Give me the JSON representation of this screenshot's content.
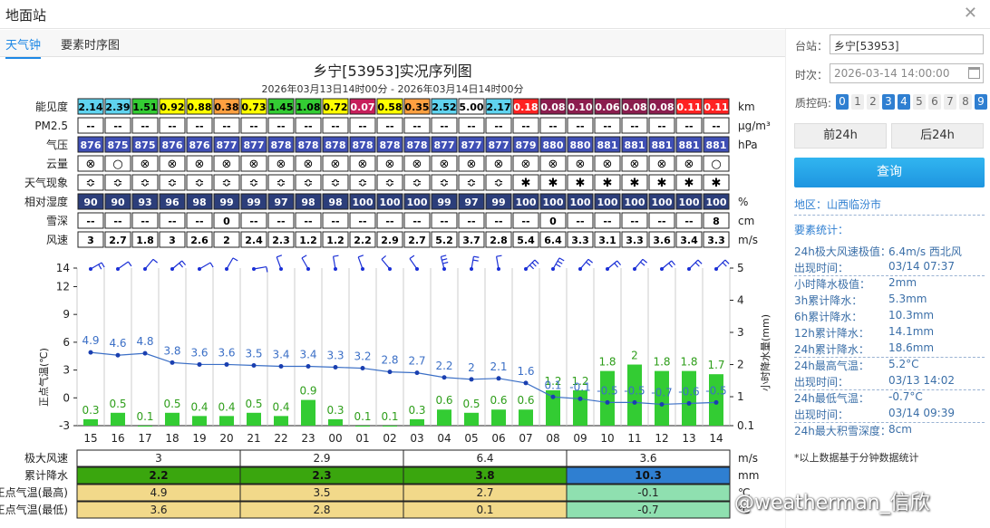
{
  "window": {
    "title": "地面站"
  },
  "tabs": [
    "天气钟",
    "要素时序图"
  ],
  "chart": {
    "title": "乡宁[53953]实况序列图",
    "subtitle": "2026年03月13日14时00分 - 2026年03月14日14时00分"
  },
  "hours": [
    "15",
    "16",
    "17",
    "18",
    "19",
    "20",
    "21",
    "22",
    "23",
    "00",
    "01",
    "02",
    "03",
    "04",
    "05",
    "06",
    "07",
    "08",
    "09",
    "10",
    "11",
    "12",
    "13",
    "14"
  ],
  "table": {
    "rows": [
      {
        "label": "能见度",
        "unit": "km",
        "values": [
          "2.14",
          "2.39",
          "1.51",
          "0.92",
          "0.88",
          "0.38",
          "0.73",
          "1.45",
          "1.08",
          "0.72",
          "0.07",
          "0.58",
          "0.35",
          "2.52",
          "5.00",
          "2.17",
          "0.18",
          "0.08",
          "0.10",
          "0.06",
          "0.08",
          "0.08",
          "0.11",
          "0.11"
        ],
        "colors": [
          "#5fd3ef",
          "#5fd3ef",
          "#33cc33",
          "#ffff00",
          "#ffff00",
          "#ffa040",
          "#ffff00",
          "#33cc33",
          "#33cc33",
          "#ffff00",
          "#c71f5b",
          "#ffff00",
          "#ffa040",
          "#5fd3ef",
          "#ffffff",
          "#5fd3ef",
          "#ff2222",
          "#8b1d4e",
          "#8b1d4e",
          "#8b1d4e",
          "#8b1d4e",
          "#8b1d4e",
          "#ff2222",
          "#ff2222"
        ]
      },
      {
        "label": "PM2.5",
        "unit": "μg/m³",
        "values": [
          "--",
          "--",
          "--",
          "--",
          "--",
          "--",
          "--",
          "--",
          "--",
          "--",
          "--",
          "--",
          "--",
          "--",
          "--",
          "--",
          "--",
          "--",
          "--",
          "--",
          "--",
          "--",
          "--",
          "--"
        ]
      },
      {
        "label": "气压",
        "unit": "hPa",
        "values": [
          "876",
          "875",
          "875",
          "876",
          "876",
          "877",
          "877",
          "878",
          "878",
          "878",
          "878",
          "878",
          "878",
          "877",
          "877",
          "877",
          "879",
          "880",
          "880",
          "881",
          "881",
          "881",
          "881",
          "881"
        ],
        "bg": "#3f4fb5"
      },
      {
        "label": "云量",
        "unit": "",
        "values": [
          "⊗",
          "○",
          "⊗",
          "⊗",
          "⊗",
          "⊗",
          "⊗",
          "⊗",
          "⊗",
          "⊗",
          "⊗",
          "⊗",
          "⊗",
          "⊗",
          "⊗",
          "⊗",
          "⊗",
          "⊗",
          "⊗",
          "⊗",
          "⊗",
          "⊗",
          "⊗",
          "○"
        ]
      },
      {
        "label": "天气现象",
        "unit": "",
        "values": [
          "≎",
          "≎",
          "≎",
          "≎",
          "≎",
          "≎",
          "≎",
          "≎",
          "≎",
          "≎",
          "≎",
          "≎",
          "≎",
          "≎",
          "≎",
          "≎",
          "✱",
          "✱",
          "✱",
          "✱",
          "✱",
          "✱",
          "✱",
          "✱"
        ]
      },
      {
        "label": "相对湿度",
        "unit": "%",
        "values": [
          "90",
          "90",
          "93",
          "96",
          "98",
          "99",
          "99",
          "97",
          "98",
          "98",
          "100",
          "100",
          "100",
          "99",
          "97",
          "99",
          "100",
          "100",
          "100",
          "100",
          "100",
          "100",
          "100",
          "100"
        ],
        "bg": "#2c3e7a"
      },
      {
        "label": "雪深",
        "unit": "cm",
        "values": [
          "--",
          "--",
          "--",
          "--",
          "--",
          "0",
          "--",
          "--",
          "--",
          "--",
          "--",
          "--",
          "--",
          "--",
          "--",
          "--",
          "--",
          "0",
          "--",
          "--",
          "--",
          "--",
          "--",
          "8"
        ]
      },
      {
        "label": "风速",
        "unit": "m/s",
        "values": [
          "3",
          "2.7",
          "1.8",
          "3",
          "2.6",
          "2",
          "2.4",
          "2.3",
          "1.2",
          "1.2",
          "2.2",
          "2.9",
          "2.7",
          "5.2",
          "3.7",
          "2.8",
          "5.4",
          "6.4",
          "3.3",
          "3.1",
          "3.3",
          "3.6",
          "3.4",
          "3.3"
        ]
      }
    ]
  },
  "plot": {
    "left_axis_label": "正点气温(℃)",
    "right_axis_label": "小时降水量(mm)",
    "left_ticks": [
      "14",
      "12",
      "9",
      "6",
      "3",
      "0",
      "-3"
    ],
    "right_ticks": [
      "5",
      "4",
      "3",
      "2",
      "1",
      "0.1"
    ]
  },
  "chart_data": {
    "type": "bar",
    "categories": [
      "15",
      "16",
      "17",
      "18",
      "19",
      "20",
      "21",
      "22",
      "23",
      "00",
      "01",
      "02",
      "03",
      "04",
      "05",
      "06",
      "07",
      "08",
      "09",
      "10",
      "11",
      "12",
      "13",
      "14"
    ],
    "series": [
      {
        "type": "bar",
        "values": [
          0.3,
          0.5,
          0.1,
          0.5,
          0.4,
          0.4,
          0.5,
          0.4,
          0.9,
          0.3,
          0.1,
          0.1,
          0.3,
          0.6,
          0.5,
          0.6,
          0.6,
          1.2,
          1.2,
          1.8,
          2,
          1.8,
          1.8,
          1.7
        ],
        "color": "#33cc33"
      },
      {
        "type": "line",
        "values": [
          4.9,
          4.6,
          4.8,
          3.8,
          3.6,
          3.6,
          3.5,
          3.4,
          3.4,
          3.3,
          3.2,
          2.8,
          2.7,
          2.2,
          2,
          2.1,
          1.6,
          0.1,
          -0.1,
          -0.5,
          -0.5,
          -0.7,
          -0.6,
          -0.5
        ],
        "color": "#3b6fc6"
      }
    ],
    "ylabel": "正点气温(℃)",
    "y2label": "小时降水量(mm)",
    "ylim": [
      -3,
      14
    ],
    "y2lim": [
      0.1,
      5
    ]
  },
  "summary": {
    "unit_labels": [
      "m/s",
      "mm",
      "℃",
      "℃"
    ],
    "rows": [
      {
        "label": "极大风速",
        "values": [
          "3",
          "2.9",
          "6.4",
          "3.6"
        ],
        "colors": [
          "#ffffff",
          "#ffffff",
          "#ffffff",
          "#ffffff"
        ]
      },
      {
        "label": "累计降水",
        "values": [
          "2.2",
          "2.3",
          "3.8",
          "10.3"
        ],
        "colors": [
          "#3aa60e",
          "#3aa60e",
          "#3aa60e",
          "#2f7fd1"
        ]
      },
      {
        "label": "正点气温(最高)",
        "values": [
          "4.9",
          "3.5",
          "2.7",
          "-0.1"
        ],
        "colors": [
          "#f2d98a",
          "#f2d98a",
          "#f2d98a",
          "#8fe0b0"
        ]
      },
      {
        "label": "正点气温(最低)",
        "values": [
          "3.6",
          "2.8",
          "0.1",
          "-0.7"
        ],
        "colors": [
          "#f2d98a",
          "#f2d98a",
          "#f2d98a",
          "#8fe0b0"
        ]
      }
    ]
  },
  "sidebar": {
    "station_label": "台站：",
    "station_value": "乡宁[53953]",
    "time_label": "时次：",
    "time_value": "2026-03-14 14:00:00",
    "qc_label": "质控码:",
    "qc_codes": [
      "0",
      "1",
      "2",
      "3",
      "4",
      "5",
      "6",
      "7",
      "8",
      "9"
    ],
    "qc_on": [
      true,
      false,
      false,
      true,
      true,
      false,
      false,
      false,
      false,
      true
    ],
    "prev_label": "前24h",
    "next_label": "后24h",
    "query_label": "查询",
    "region": "地区：山西临汾市",
    "stats_title": "要素统计：",
    "stats": [
      {
        "label": "24h极大风速极值：",
        "value": "6.4m/s 西北风"
      },
      {
        "label": "出现时间：",
        "value": "03/14 07:37"
      },
      {
        "label": "小时降水极值：",
        "value": "2mm"
      },
      {
        "label": "3h累计降水：",
        "value": "5.3mm"
      },
      {
        "label": "6h累计降水：",
        "value": "10.3mm"
      },
      {
        "label": "12h累计降水：",
        "value": "14.1mm"
      },
      {
        "label": "24h累计降水：",
        "value": "18.6mm"
      },
      {
        "label": "24h最高气温：",
        "value": "5.2°C"
      },
      {
        "label": "出现时间：",
        "value": "03/13 14:02"
      },
      {
        "label": "24h最低气温：",
        "value": "-0.7°C"
      },
      {
        "label": "出现时间：",
        "value": "03/14 09:39"
      },
      {
        "label": "24h最大积雪深度：",
        "value": "8cm"
      }
    ],
    "footnote": "*以上数据基于分钟数据统计"
  },
  "watermark": "@weatherman_信欣",
  "colors": {
    "accent": "#1e88e5",
    "bar": "#33cc33",
    "line": "#3b6fc6",
    "wind": "#1a2fd6"
  }
}
